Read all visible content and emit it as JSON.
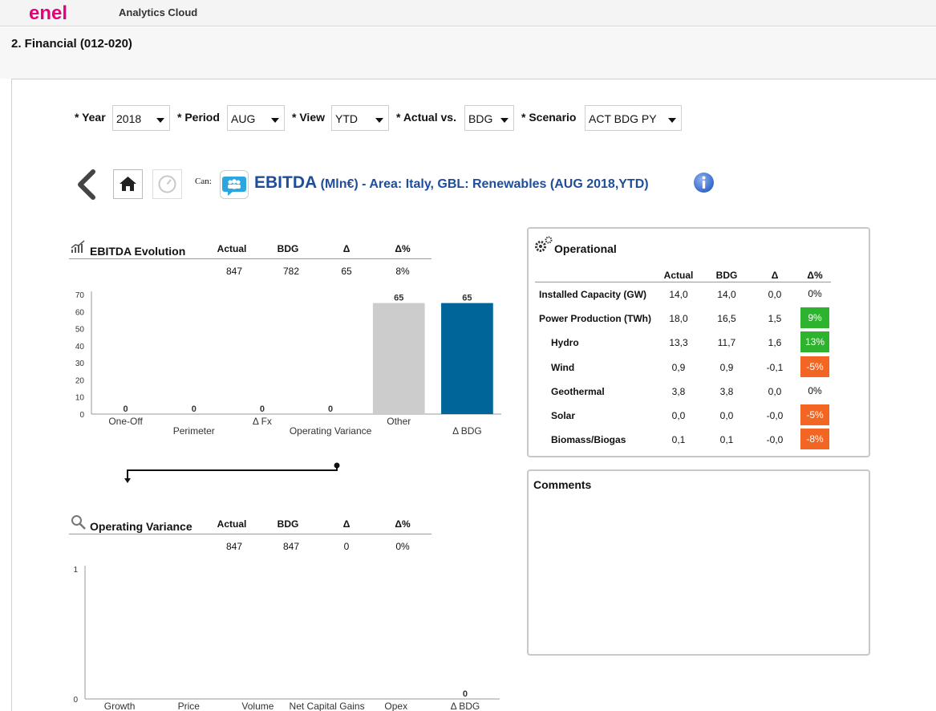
{
  "app": {
    "logo_text": "enel",
    "title": "Analytics Cloud"
  },
  "page_title": "2. Financial (012-020)",
  "filters": [
    {
      "label": "* Year",
      "value": "2018"
    },
    {
      "label": "* Period",
      "value": "AUG"
    },
    {
      "label": "* View",
      "value": "YTD"
    },
    {
      "label": "* Actual vs.",
      "value": "BDG"
    },
    {
      "label": "* Scenario",
      "value": "ACT BDG PY"
    }
  ],
  "header": {
    "can_label": "Can:",
    "kpi_title_main": "EBITDA",
    "kpi_title_unit": " (Mln€) - Area: Italy, GBL: Renewables (AUG 2018,YTD)"
  },
  "ebitda_evolution": {
    "title": "EBITDA Evolution",
    "columns": [
      "Actual",
      "BDG",
      "Δ",
      "Δ%"
    ],
    "values": [
      "847",
      "782",
      "65",
      "8%"
    ]
  },
  "operating_variance": {
    "title": "Operating Variance",
    "columns": [
      "Actual",
      "BDG",
      "Δ",
      "Δ%"
    ],
    "values": [
      "847",
      "847",
      "0",
      "0%"
    ]
  },
  "operational": {
    "title": "Operational",
    "columns": [
      "Actual",
      "BDG",
      "Δ",
      "Δ%"
    ],
    "rows": [
      {
        "label": "Installed Capacity (GW)",
        "actual": "14,0",
        "bdg": "14,0",
        "delta": "0,0",
        "pct": "0%",
        "status": "none",
        "indent": false
      },
      {
        "label": "Power Production (TWh)",
        "actual": "18,0",
        "bdg": "16,5",
        "delta": "1,5",
        "pct": "9%",
        "status": "green",
        "indent": false
      },
      {
        "label": "Hydro",
        "actual": "13,3",
        "bdg": "11,7",
        "delta": "1,6",
        "pct": "13%",
        "status": "green",
        "indent": true
      },
      {
        "label": "Wind",
        "actual": "0,9",
        "bdg": "0,9",
        "delta": "-0,1",
        "pct": "-5%",
        "status": "orange",
        "indent": true
      },
      {
        "label": "Geothermal",
        "actual": "3,8",
        "bdg": "3,8",
        "delta": "0,0",
        "pct": "0%",
        "status": "none",
        "indent": true
      },
      {
        "label": "Solar",
        "actual": "0,0",
        "bdg": "0,0",
        "delta": "-0,0",
        "pct": "-5%",
        "status": "orange",
        "indent": true
      },
      {
        "label": "Biomass/Biogas",
        "actual": "0,1",
        "bdg": "0,1",
        "delta": "-0,0",
        "pct": "-8%",
        "status": "orange",
        "indent": true
      }
    ],
    "colors": {
      "green": "#2db32d",
      "orange": "#f26522"
    }
  },
  "comments": {
    "title": "Comments"
  },
  "chart_data": [
    {
      "type": "bar",
      "title": "EBITDA Evolution",
      "categories": [
        "One-Off",
        "Perimeter",
        "Δ Fx",
        "Operating Variance",
        "Other",
        "Δ BDG"
      ],
      "values": [
        0,
        0,
        0,
        0,
        65,
        65
      ],
      "value_labels": [
        "0",
        "0",
        "0",
        "0",
        "65",
        "65"
      ],
      "bar_colors": [
        "#cccccc",
        "#cccccc",
        "#cccccc",
        "#cccccc",
        "#cccccc",
        "#006699"
      ],
      "yticks": [
        0,
        10,
        20,
        30,
        40,
        50,
        60,
        70
      ],
      "ylim": [
        0,
        70
      ],
      "grid": false
    },
    {
      "type": "bar",
      "title": "Operating Variance",
      "categories": [
        "Growth",
        "Price",
        "Volume",
        "Net Capital Gains",
        "Opex",
        "Δ BDG"
      ],
      "values": [
        0,
        0,
        0,
        0,
        0,
        0
      ],
      "value_labels": [
        "",
        "",
        "",
        "",
        "",
        "0"
      ],
      "yticks": [
        0,
        1
      ],
      "ylim": [
        0,
        1
      ],
      "grid": false
    }
  ]
}
